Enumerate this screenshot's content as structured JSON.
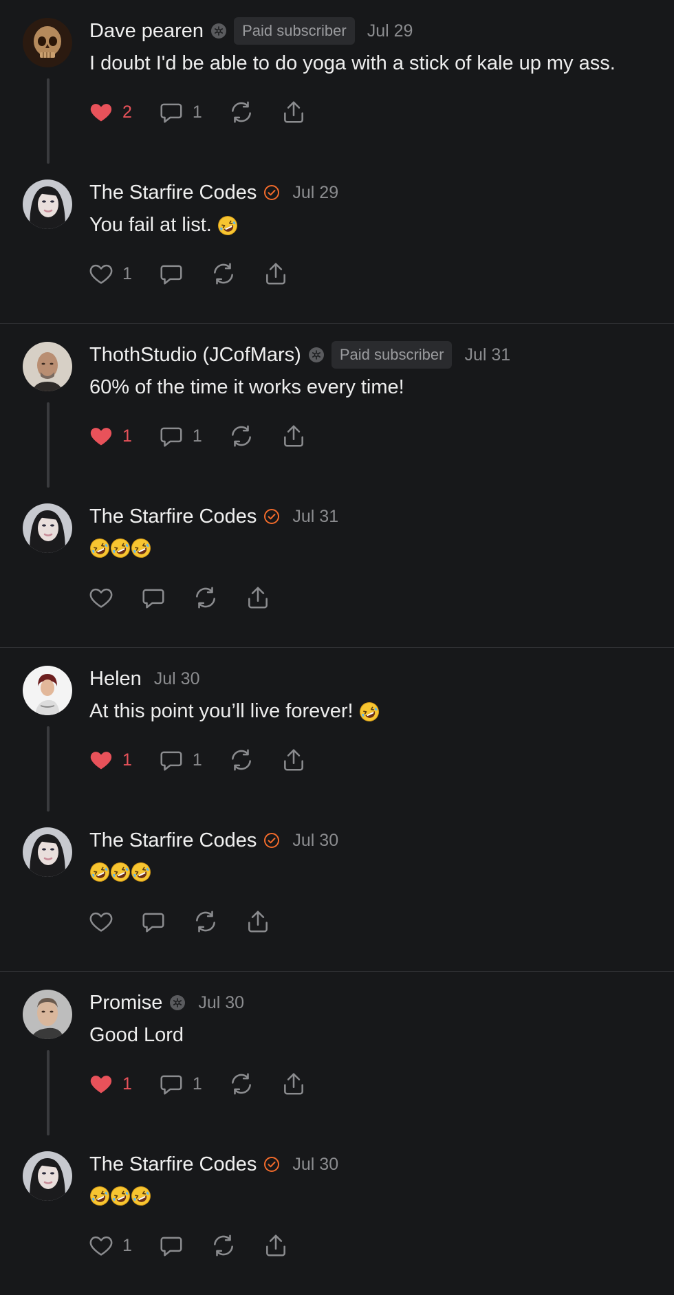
{
  "colors": {
    "background": "#17181a",
    "like_active": "#e8525a",
    "verified": "#f26b2b",
    "muted": "#8b8c8f"
  },
  "icons": [
    "heart-icon",
    "comment-icon",
    "restack-icon",
    "share-icon",
    "subscriber-badge-icon",
    "verified-badge-icon",
    "rofl-emoji"
  ],
  "threads": [
    {
      "comments": [
        {
          "name": "Dave pearen",
          "badge": "subscriber",
          "paid": "Paid subscriber",
          "date": "Jul 29",
          "text": "I doubt I'd be able to do yoga with a stick of kale up my ass.",
          "emojis": 0,
          "liked": true,
          "likes": "2",
          "replies": "1"
        },
        {
          "name": "The Starfire Codes",
          "badge": "verified",
          "paid": "",
          "date": "Jul 29",
          "text": "You fail at list.",
          "emojis": 1,
          "liked": false,
          "likes": "1",
          "replies": ""
        }
      ]
    },
    {
      "comments": [
        {
          "name": "ThothStudio (JCofMars)",
          "badge": "subscriber",
          "paid": "Paid subscriber",
          "date": "Jul 31",
          "text": "60% of the time it works every time!",
          "emojis": 0,
          "liked": true,
          "likes": "1",
          "replies": "1"
        },
        {
          "name": "The Starfire Codes",
          "badge": "verified",
          "paid": "",
          "date": "Jul 31",
          "text": "",
          "emojis": 3,
          "liked": false,
          "likes": "",
          "replies": ""
        }
      ]
    },
    {
      "comments": [
        {
          "name": "Helen",
          "badge": "",
          "paid": "",
          "date": "Jul 30",
          "text": "At this point you’ll live forever!",
          "emojis": 1,
          "liked": true,
          "likes": "1",
          "replies": "1"
        },
        {
          "name": "The Starfire Codes",
          "badge": "verified",
          "paid": "",
          "date": "Jul 30",
          "text": "",
          "emojis": 3,
          "liked": false,
          "likes": "",
          "replies": ""
        }
      ]
    },
    {
      "comments": [
        {
          "name": "Promise",
          "badge": "subscriber",
          "paid": "",
          "date": "Jul 30",
          "text": "Good Lord",
          "emojis": 0,
          "liked": true,
          "likes": "1",
          "replies": "1"
        },
        {
          "name": "The Starfire Codes",
          "badge": "verified",
          "paid": "",
          "date": "Jul 30",
          "text": "",
          "emojis": 3,
          "liked": false,
          "likes": "1",
          "replies": ""
        }
      ]
    }
  ]
}
